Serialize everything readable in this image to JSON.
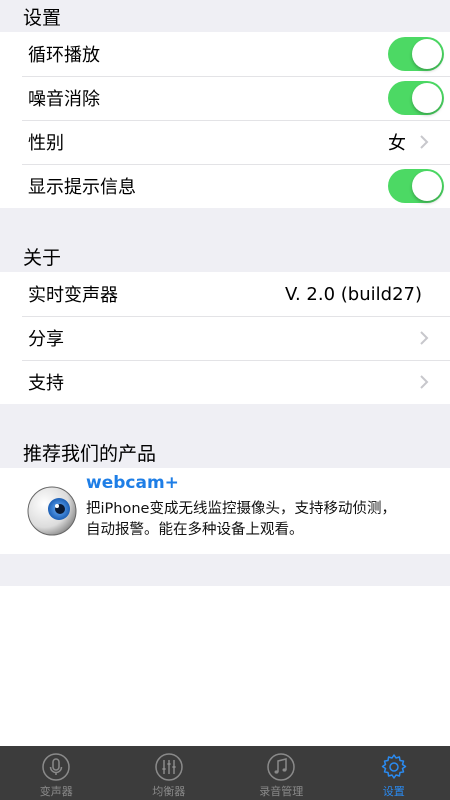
{
  "settings": {
    "header": "设置",
    "items": [
      {
        "label": "循环播放",
        "toggle": true
      },
      {
        "label": "噪音消除",
        "toggle": true
      },
      {
        "label": "性别",
        "value": "女"
      },
      {
        "label": "显示提示信息",
        "toggle": true
      }
    ]
  },
  "about": {
    "header": "关于",
    "items": [
      {
        "label": "实时变声器",
        "value": "V. 2.0 (build27)"
      },
      {
        "label": "分享"
      },
      {
        "label": "支持"
      }
    ]
  },
  "products": {
    "header": "推荐我们的产品",
    "item": {
      "name": "webcam+",
      "description_line1": "把iPhone变成无线监控摄像头，支持移动侦测，",
      "description_line2": "自动报警。能在多种设备上观看。",
      "icon": "eye-icon"
    }
  },
  "tabbar": {
    "tabs": [
      {
        "label": "变声器",
        "icon": "microphone-icon",
        "active": false
      },
      {
        "label": "均衡器",
        "icon": "equalizer-icon",
        "active": false
      },
      {
        "label": "录音管理",
        "icon": "music-note-icon",
        "active": false
      },
      {
        "label": "设置",
        "icon": "gear-icon",
        "active": true
      }
    ]
  },
  "colors": {
    "toggle_on": "#4cd964",
    "accent": "#2a8bf2",
    "tabbar_bg": "#3c3c3c",
    "group_bg": "#efeff4"
  }
}
